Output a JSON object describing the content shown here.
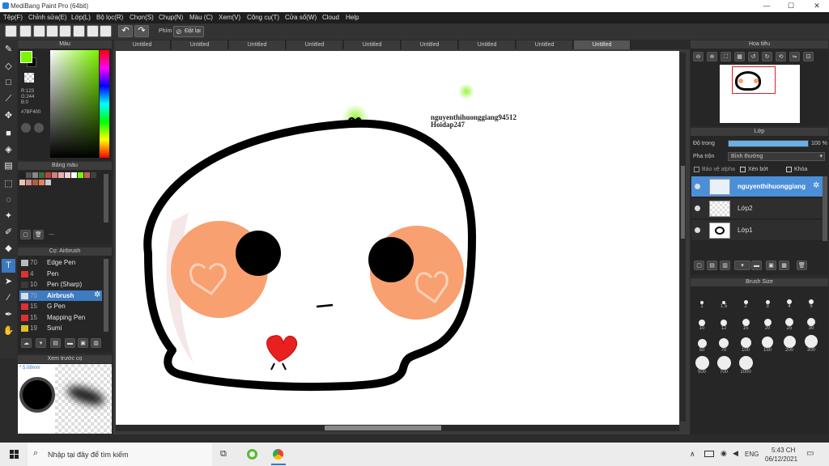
{
  "window": {
    "title": "MediBang Paint Pro (64bit)"
  },
  "menu": [
    "Tệp(F)",
    "Chỉnh sửa(E)",
    "Lớp(L)",
    "Bộ lọc(R)",
    "Chọn(S)",
    "Chụp(N)",
    "Màu (C)",
    "Xem(V)",
    "Công cụ(T)",
    "Cửa sổ(W)",
    "Cloud",
    "Help"
  ],
  "toolbar": {
    "phim_label": "Phím",
    "reset_label": "Đặt lại"
  },
  "tabs": [
    "Untitled",
    "Untitled",
    "Untitled",
    "Untitled",
    "Untitled",
    "Untitled",
    "Untitled",
    "Untitled",
    "Untitled"
  ],
  "color_panel": {
    "title": "Màu",
    "r": "R:123",
    "g": "G:244",
    "b": "B:0",
    "hex": "#7BF400",
    "fg": "#7BF400",
    "bg": "#000000"
  },
  "palette_panel": {
    "title": "Bảng màu",
    "dashes": "---"
  },
  "brush_panel": {
    "title": "Cọ: Airbrush",
    "items": [
      {
        "num": "70",
        "name": "Edge Pen",
        "color": "#b9b9b9"
      },
      {
        "num": "4",
        "name": "Pen",
        "color": "#e03030"
      },
      {
        "num": "10",
        "name": "Pen (Sharp)",
        "color": "#3a3a3a"
      },
      {
        "num": "70",
        "name": "Airbrush",
        "color": "#dddddd"
      },
      {
        "num": "15",
        "name": "G Pen",
        "color": "#e03030"
      },
      {
        "num": "15",
        "name": "Mapping Pen",
        "color": "#e03030"
      },
      {
        "num": "19",
        "name": "Sumi",
        "color": "#e0c020"
      }
    ]
  },
  "preview_panel": {
    "title": "Xem trước cọ",
    "size": "* 5.08mm"
  },
  "canvas": {
    "watermark_line1": "nguyenthihuonggiang94512",
    "watermark_line2": "Hoidap247"
  },
  "navigator": {
    "title": "Hoa tiêu"
  },
  "layer_panel": {
    "title": "Lớp",
    "opacity_label": "Độ trong",
    "opacity_value": "100 %",
    "opacity": 1.0,
    "blend_label": "Pha trộn",
    "blend_value": "Bình thường",
    "alpha_label": "Bảo vệ alpha",
    "clip_label": "Xén bớt",
    "lock_label": "Khóa",
    "layers": [
      {
        "name": "nguyenthihuonggiang"
      },
      {
        "name": "Lớp2"
      },
      {
        "name": "Lớp1"
      }
    ]
  },
  "brush_size_panel": {
    "title": "Brush Size",
    "sizes": [
      "1",
      "1.5",
      "2",
      "3",
      "4",
      "5",
      "10",
      "12",
      "15",
      "20",
      "25",
      "30",
      "50",
      "70",
      "100",
      "150",
      "200",
      "300",
      "500",
      "700",
      "1000"
    ]
  },
  "taskbar": {
    "search_placeholder": "Nhập tại đây để tìm kiếm",
    "lang": "ENG",
    "time": "5:43 CH",
    "date": "06/12/2021"
  }
}
